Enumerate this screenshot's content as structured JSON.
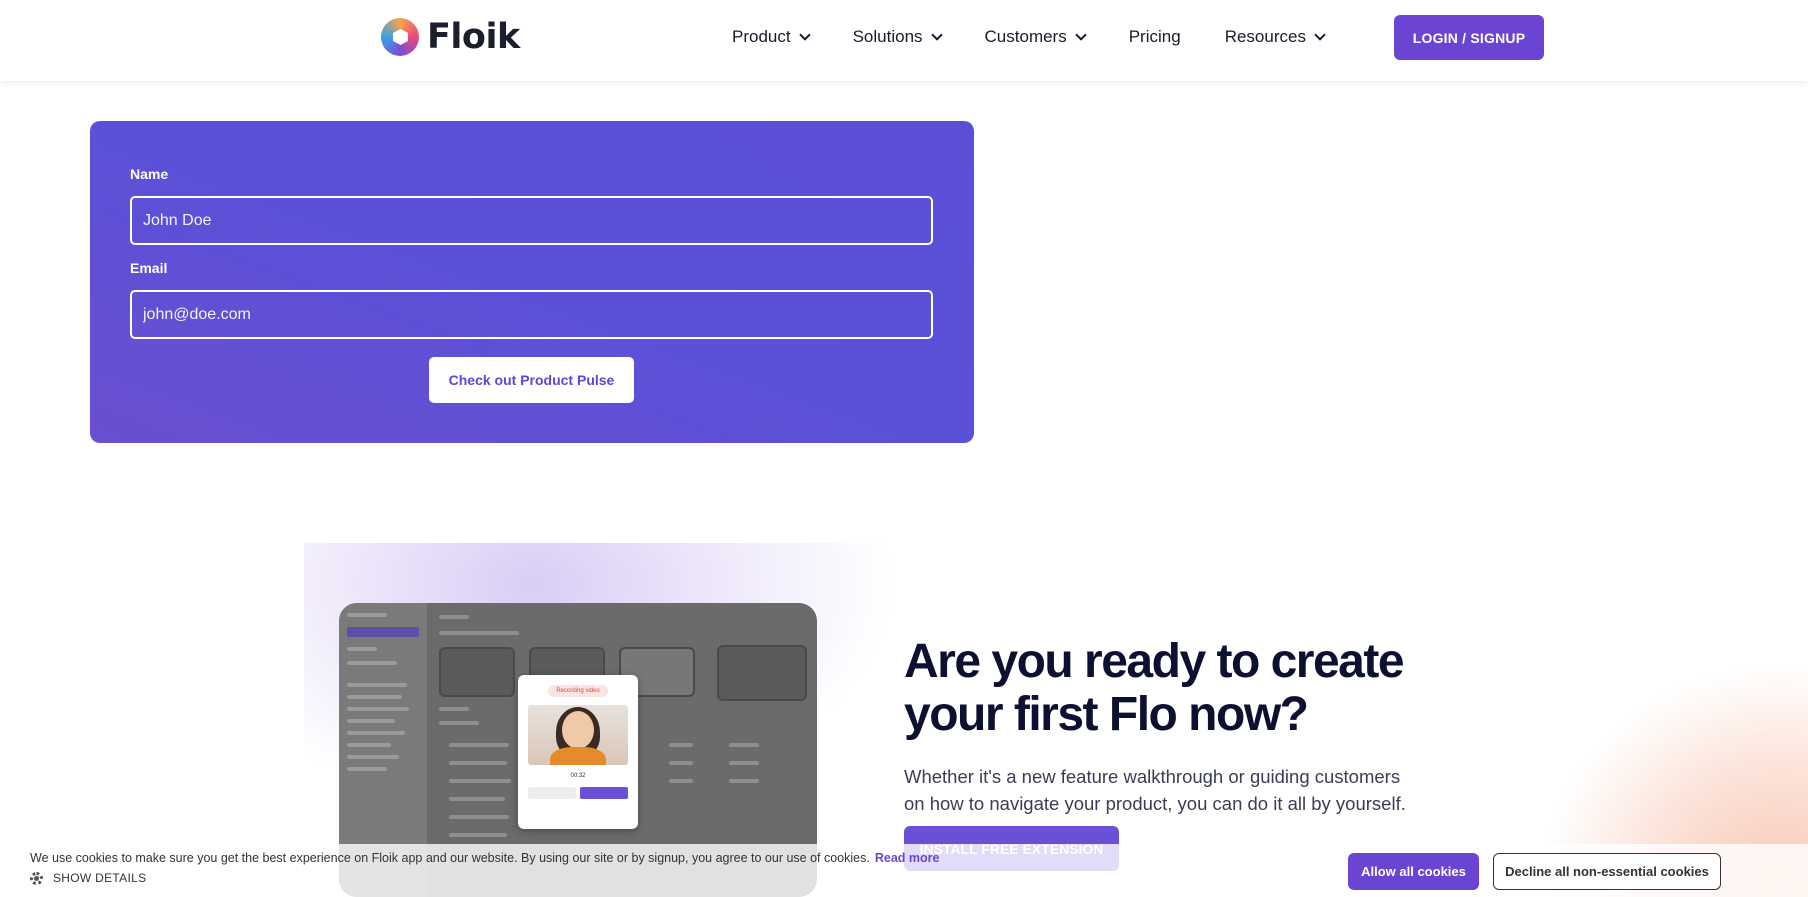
{
  "brand": {
    "name": "Floik"
  },
  "nav": {
    "items": [
      {
        "label": "Product",
        "has_dropdown": true
      },
      {
        "label": "Solutions",
        "has_dropdown": true
      },
      {
        "label": "Customers",
        "has_dropdown": true
      },
      {
        "label": "Pricing",
        "has_dropdown": false
      },
      {
        "label": "Resources",
        "has_dropdown": true
      }
    ],
    "login_label": "LOGIN / SIGNUP"
  },
  "form": {
    "name_label": "Name",
    "name_placeholder": "John Doe",
    "email_label": "Email",
    "email_placeholder": "john@doe.com",
    "submit_label": "Check out Product Pulse"
  },
  "cta": {
    "title": "Are you ready to create your first Flo now?",
    "subtitle": "Whether it's a new feature walkthrough or guiding customers on how to navigate your product, you can do it all by yourself.",
    "button_label": "INSTALL FREE EXTENSION",
    "preview": {
      "recording_label": "Recording video",
      "timer": "00:32"
    }
  },
  "cookie": {
    "text": "We use cookies to make sure you get the best experience on Floik app and our website. By using our site or by signup, you agree to our use of cookies.",
    "read_more": "Read more",
    "show_details": "SHOW DETAILS",
    "allow_label": "Allow all cookies",
    "decline_label": "Decline all non-essential cookies"
  },
  "colors": {
    "accent": "#6b45d1",
    "form_bg": "#5b4fd6",
    "heading": "#0d1030"
  },
  "icons": {
    "logo": "floik-logo-icon",
    "dropdown": "chevron-down-icon",
    "settings": "gear-icon"
  }
}
